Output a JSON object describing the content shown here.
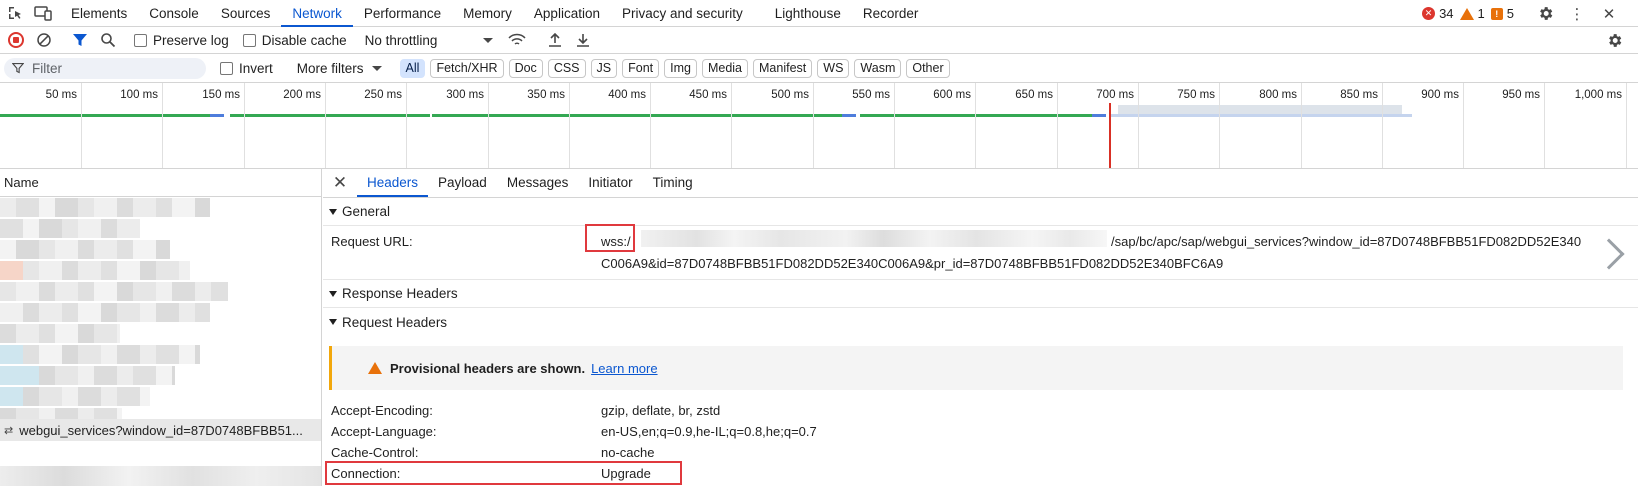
{
  "tabs": [
    "Elements",
    "Console",
    "Sources",
    "Network",
    "Performance",
    "Memory",
    "Application",
    "Privacy and security",
    "Lighthouse",
    "Recorder"
  ],
  "active_tab": "Network",
  "status": {
    "errors": "34",
    "warnings": "1",
    "issues": "5"
  },
  "toolbar": {
    "preserve_log": "Preserve log",
    "disable_cache": "Disable cache",
    "throttling": "No throttling"
  },
  "filter": {
    "placeholder": "Filter",
    "invert": "Invert",
    "more_filters": "More filters",
    "types": [
      "All",
      "Fetch/XHR",
      "Doc",
      "CSS",
      "JS",
      "Font",
      "Img",
      "Media",
      "Manifest",
      "WS",
      "Wasm",
      "Other"
    ],
    "active_type": "All"
  },
  "timeline": {
    "ticks": [
      "50 ms",
      "100 ms",
      "150 ms",
      "200 ms",
      "250 ms",
      "300 ms",
      "350 ms",
      "400 ms",
      "450 ms",
      "500 ms",
      "550 ms",
      "600 ms",
      "650 ms",
      "700 ms",
      "750 ms",
      "800 ms",
      "850 ms",
      "900 ms",
      "950 ms",
      "1,000 ms"
    ]
  },
  "name_pane": {
    "header": "Name",
    "selected_request": "webgui_services?window_id=87D0748BFBB51..."
  },
  "details": {
    "tabs": [
      "Headers",
      "Payload",
      "Messages",
      "Initiator",
      "Timing"
    ],
    "active_tab": "Headers",
    "general_label": "General",
    "request_url_label": "Request URL:",
    "request_url_scheme": "wss:/",
    "request_url_path": "/sap/bc/apc/sap/webgui_services?window_id=87D0748BFBB51FD082DD52E340",
    "request_url_line2": "C006A9&id=87D0748BFBB51FD082DD52E340C006A9&pr_id=87D0748BFBB51FD082DD52E340BFC6A9",
    "response_headers_label": "Response Headers",
    "request_headers_label": "Request Headers",
    "provisional_warning": "Provisional headers are shown.",
    "learn_more": "Learn more",
    "headers": [
      {
        "key": "Accept-Encoding:",
        "value": "gzip, deflate, br, zstd"
      },
      {
        "key": "Accept-Language:",
        "value": "en-US,en;q=0.9,he-IL;q=0.8,he;q=0.7"
      },
      {
        "key": "Cache-Control:",
        "value": "no-cache"
      },
      {
        "key": "Connection:",
        "value": "Upgrade"
      }
    ]
  },
  "colors": {
    "accent": "#0b57d0",
    "highlight_box": "#e0393e",
    "error": "#dc362e",
    "warning": "#e8710a"
  }
}
